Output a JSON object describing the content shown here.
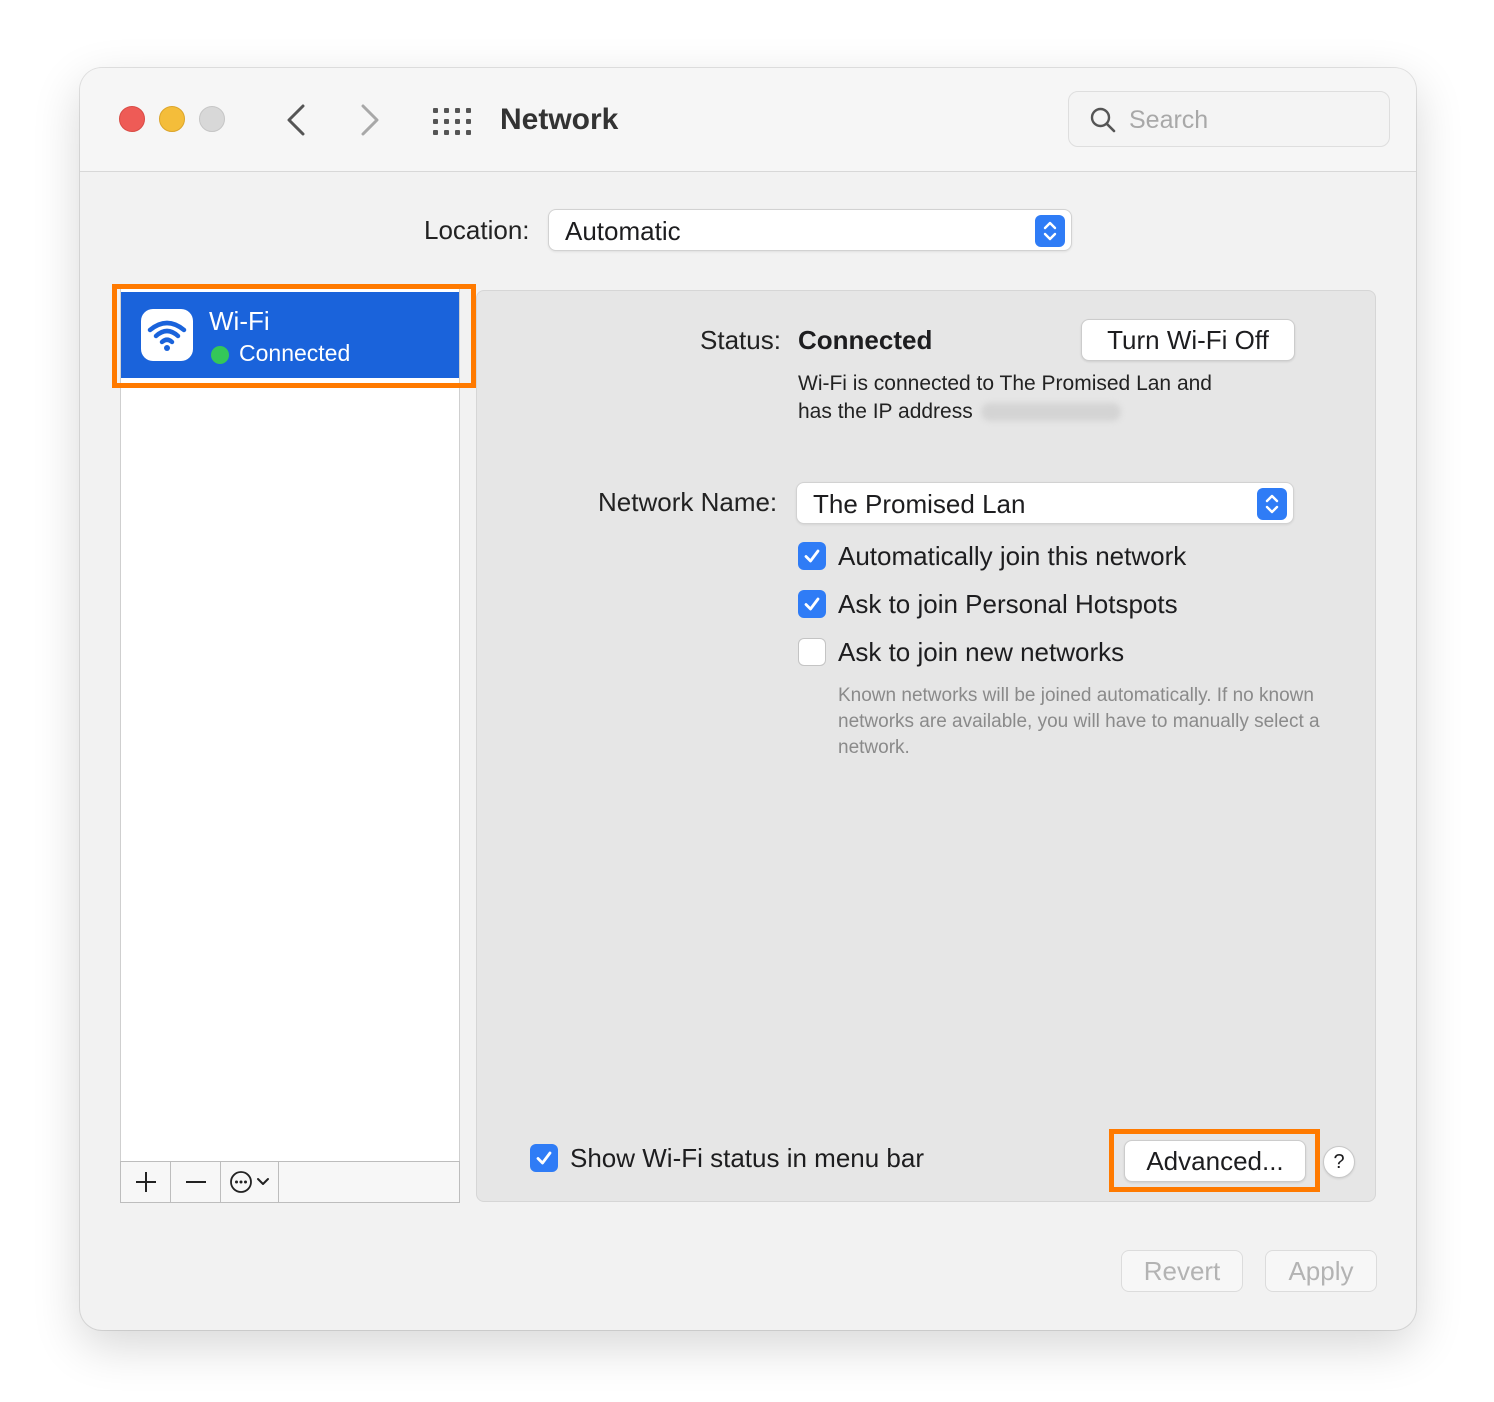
{
  "window": {
    "title": "Network",
    "search_placeholder": "Search"
  },
  "location": {
    "label": "Location:",
    "value": "Automatic"
  },
  "sidebar": {
    "services": [
      {
        "name": "Wi-Fi",
        "status": "Connected",
        "status_color": "#34c759",
        "selected": true
      }
    ],
    "toolbar": {
      "add": "+",
      "remove": "—"
    }
  },
  "main": {
    "status_label": "Status:",
    "status_value": "Connected",
    "turn_off_button": "Turn Wi-Fi Off",
    "status_description_line1": "Wi-Fi is connected to The Promised Lan and",
    "status_description_line2": "has the IP address",
    "network_name_label": "Network Name:",
    "network_name_value": "The Promised Lan",
    "checkboxes": [
      {
        "label": "Automatically join this network",
        "checked": true
      },
      {
        "label": "Ask to join Personal Hotspots",
        "checked": true
      },
      {
        "label": "Ask to join new networks",
        "checked": false
      }
    ],
    "hint": "Known networks will be joined automatically. If no known networks are available, you will have to manually select a network.",
    "show_status_label": "Show Wi-Fi status in menu bar",
    "show_status_checked": true,
    "advanced_button": "Advanced...",
    "help_button": "?"
  },
  "footer": {
    "revert_button": "Revert",
    "apply_button": "Apply"
  },
  "colors": {
    "accent": "#2f7cf6",
    "selection": "#1a63db",
    "highlight": "#ff7a00"
  }
}
